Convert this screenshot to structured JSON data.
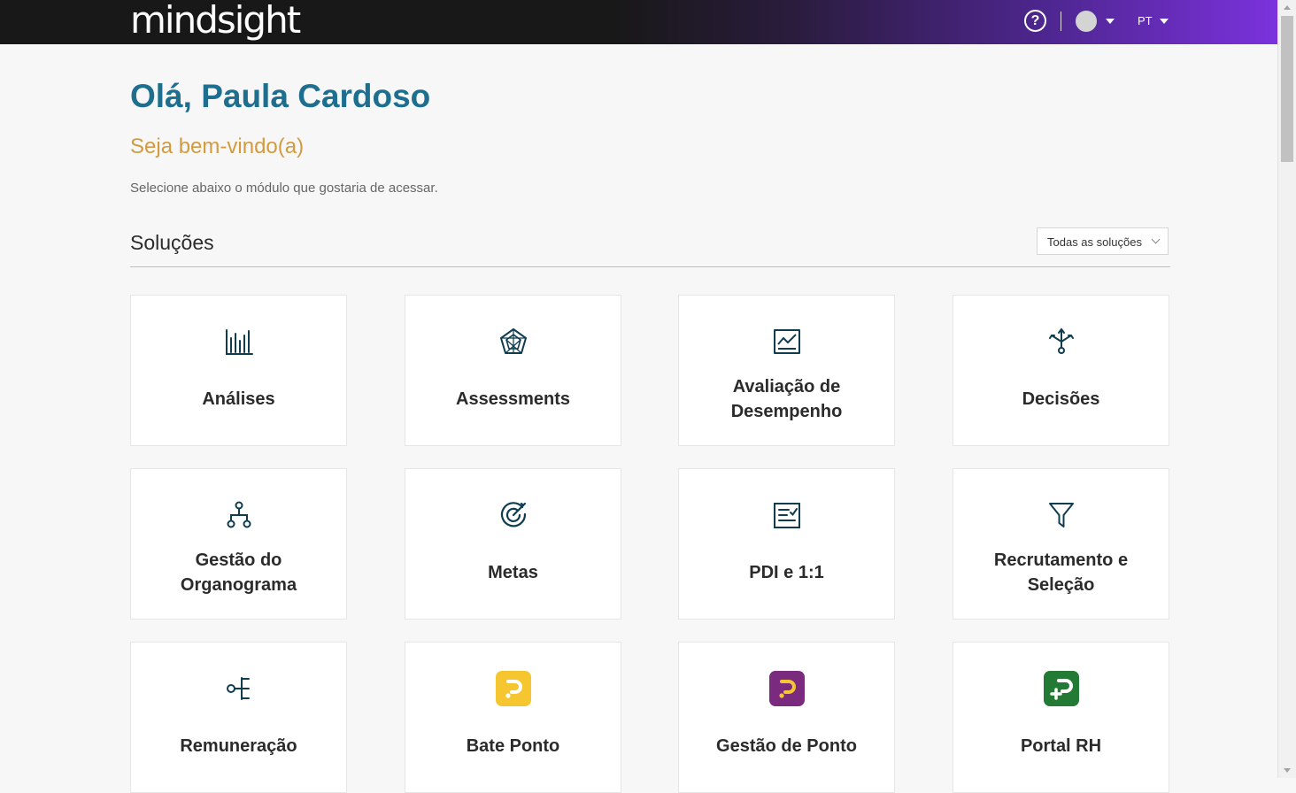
{
  "header": {
    "logo": "mindsight",
    "help_glyph": "?",
    "help_icon": "help-circle-icon",
    "avatar_icon": "user-avatar",
    "language": "PT"
  },
  "welcome": {
    "greeting": "Olá, Paula Cardoso",
    "subtitle": "Seja bem-vindo(a)",
    "instruction": "Selecione abaixo o módulo que gostaria de acessar."
  },
  "solutions": {
    "title": "Soluções",
    "filter_value": "Todas as soluções",
    "modules": [
      {
        "label": "Análises",
        "icon": "bar-chart-icon"
      },
      {
        "label": "Assessments",
        "icon": "radar-icon"
      },
      {
        "label": "Avaliação de Desempenho",
        "icon": "line-chart-icon"
      },
      {
        "label": "Decisões",
        "icon": "split-arrows-icon"
      },
      {
        "label": "Gestão do Organograma",
        "icon": "org-chart-icon"
      },
      {
        "label": "Metas",
        "icon": "target-icon"
      },
      {
        "label": "PDI e 1:1",
        "icon": "checklist-icon"
      },
      {
        "label": "Recrutamento e Seleção",
        "icon": "funnel-icon"
      },
      {
        "label": "Remuneração",
        "icon": "compensation-icon"
      },
      {
        "label": "Bate Ponto",
        "icon": "bate-ponto-logo",
        "color": "#f6c630"
      },
      {
        "label": "Gestão de Ponto",
        "icon": "gestao-ponto-logo",
        "color": "#7a2b7e"
      },
      {
        "label": "Portal RH",
        "icon": "portal-rh-logo",
        "color": "#237a35"
      }
    ]
  },
  "colors": {
    "greeting": "#1d6e8f",
    "subtitle": "#d39b3f",
    "icon_stroke": "#0f3d50",
    "header_gradient_end": "#7b32dd"
  }
}
